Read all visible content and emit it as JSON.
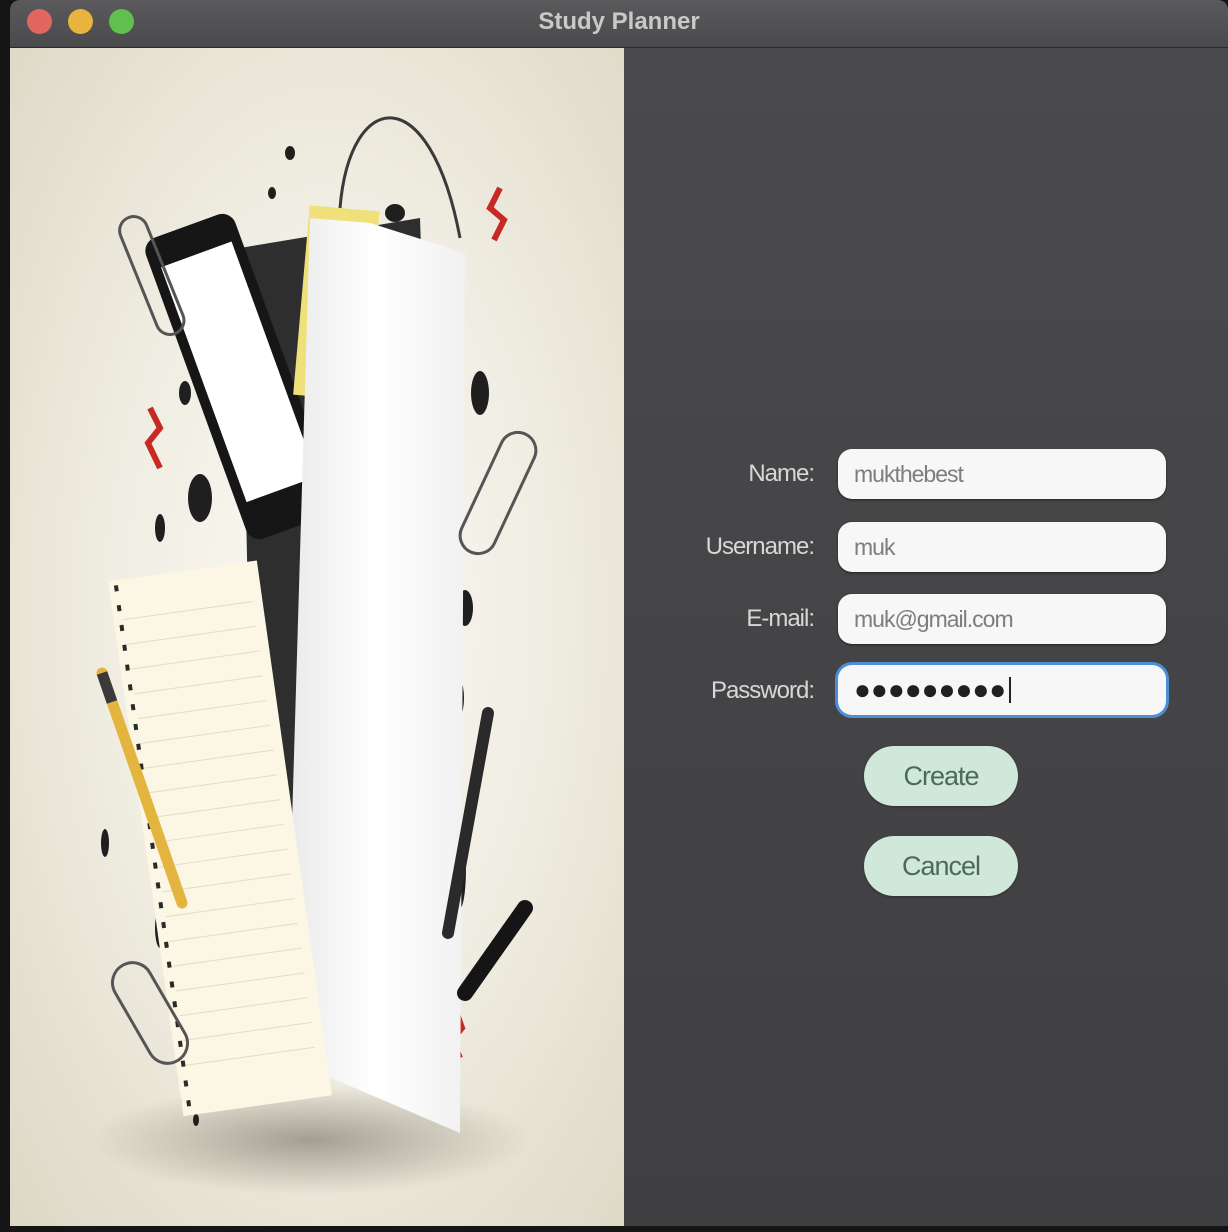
{
  "window": {
    "title": "Study Planner"
  },
  "form": {
    "name": {
      "label": "Name:",
      "value": "mukthebest"
    },
    "username": {
      "label": "Username:",
      "value": "muk"
    },
    "email": {
      "label": "E-mail:",
      "value": "muk@gmail.com"
    },
    "password": {
      "label": "Password:",
      "masked_value": "●●●●●●●●●"
    }
  },
  "buttons": {
    "create_label": "Create",
    "cancel_label": "Cancel"
  },
  "colors": {
    "panel_background": "#444446",
    "button_fill": "#cfe8da",
    "focus_ring": "#4d8fd6",
    "close": "#e2665d",
    "minimize": "#e8b43e",
    "maximize": "#5fc04e"
  },
  "icons": [
    "close-icon",
    "minimize-icon",
    "maximize-icon"
  ]
}
